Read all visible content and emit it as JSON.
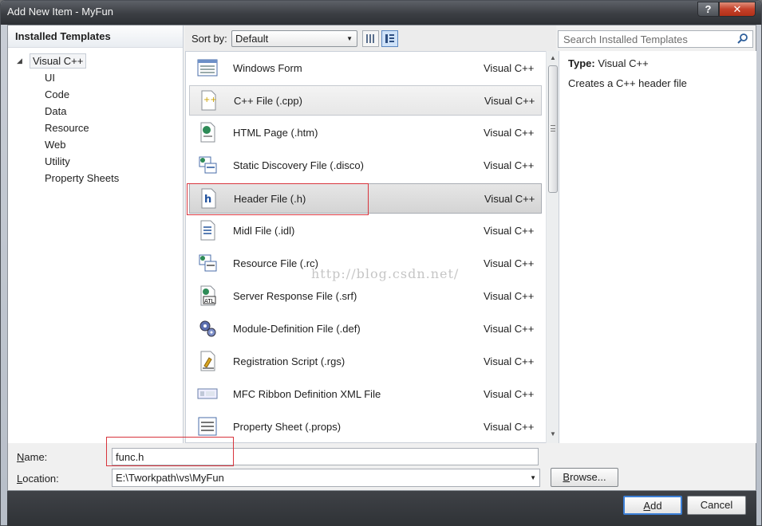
{
  "window": {
    "title": "Add New Item - MyFun",
    "help_label": "?",
    "close_label": "✕"
  },
  "left": {
    "header": "Installed Templates",
    "root": "Visual C++",
    "children": [
      "UI",
      "Code",
      "Data",
      "Resource",
      "Web",
      "Utility",
      "Property Sheets"
    ]
  },
  "sort": {
    "label": "Sort by:",
    "value": "Default"
  },
  "search": {
    "placeholder": "Search Installed Templates"
  },
  "items": [
    {
      "name": "Windows Form",
      "lang": "Visual C++",
      "icon": "windows-form-icon"
    },
    {
      "name": "C++ File (.cpp)",
      "lang": "Visual C++",
      "icon": "cpp-file-icon"
    },
    {
      "name": "HTML Page (.htm)",
      "lang": "Visual C++",
      "icon": "html-page-icon"
    },
    {
      "name": "Static Discovery File (.disco)",
      "lang": "Visual C++",
      "icon": "discovery-file-icon"
    },
    {
      "name": "Header File (.h)",
      "lang": "Visual C++",
      "icon": "header-file-icon"
    },
    {
      "name": "Midl File (.idl)",
      "lang": "Visual C++",
      "icon": "midl-file-icon"
    },
    {
      "name": "Resource File (.rc)",
      "lang": "Visual C++",
      "icon": "resource-file-icon"
    },
    {
      "name": "Server Response File (.srf)",
      "lang": "Visual C++",
      "icon": "server-response-icon"
    },
    {
      "name": "Module-Definition File (.def)",
      "lang": "Visual C++",
      "icon": "module-definition-icon"
    },
    {
      "name": "Registration Script (.rgs)",
      "lang": "Visual C++",
      "icon": "registration-script-icon"
    },
    {
      "name": "MFC Ribbon Definition XML File",
      "lang": "Visual C++",
      "icon": "ribbon-xml-icon"
    },
    {
      "name": "Property Sheet (.props)",
      "lang": "Visual C++",
      "icon": "property-sheet-icon"
    }
  ],
  "details": {
    "type_label": "Type:",
    "type_value": "Visual C++",
    "description": "Creates a C++ header file"
  },
  "watermark": "http://blog.csdn.net/",
  "form": {
    "name_label": "Name:",
    "name_value": "func.h",
    "location_label": "Location:",
    "location_value": "E:\\Tworkpath\\vs\\MyFun",
    "browse_label": "Browse...",
    "add_label": "Add",
    "cancel_label": "Cancel"
  },
  "colors": {
    "selection": "#d4d4d4",
    "highlight_box": "#d8343c",
    "accent": "#3c7fd6"
  }
}
